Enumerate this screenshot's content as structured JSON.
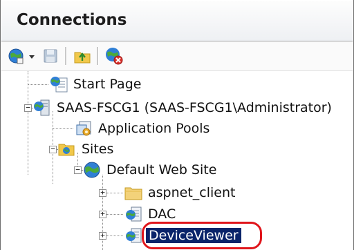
{
  "panel": {
    "title": "Connections"
  },
  "toolbar": {
    "buttons": [
      {
        "name": "connect",
        "icon": "globe-connect-icon"
      },
      {
        "name": "save",
        "icon": "save-icon"
      },
      {
        "name": "up",
        "icon": "folder-up-icon"
      },
      {
        "name": "remove",
        "icon": "remove-connection-icon"
      }
    ]
  },
  "tree": {
    "items": [
      {
        "label": "Start Page",
        "icon": "start-page-icon"
      },
      {
        "label": "SAAS-FSCG1 (SAAS-FSCG1\\Administrator)",
        "icon": "server-icon",
        "expanded": true
      },
      {
        "label": "Application Pools",
        "icon": "app-pools-icon"
      },
      {
        "label": "Sites",
        "icon": "sites-folder-icon",
        "expanded": true
      },
      {
        "label": "Default Web Site",
        "icon": "globe-icon",
        "expanded": true
      },
      {
        "label": "aspnet_client",
        "icon": "folder-icon",
        "expanded": false
      },
      {
        "label": "DAC",
        "icon": "web-app-icon",
        "expanded": false
      },
      {
        "label": "DeviceViewer",
        "icon": "web-app-icon",
        "expanded": false,
        "selected": true
      }
    ]
  },
  "colors": {
    "selection": "#0a246a",
    "highlight": "#e0151b"
  }
}
